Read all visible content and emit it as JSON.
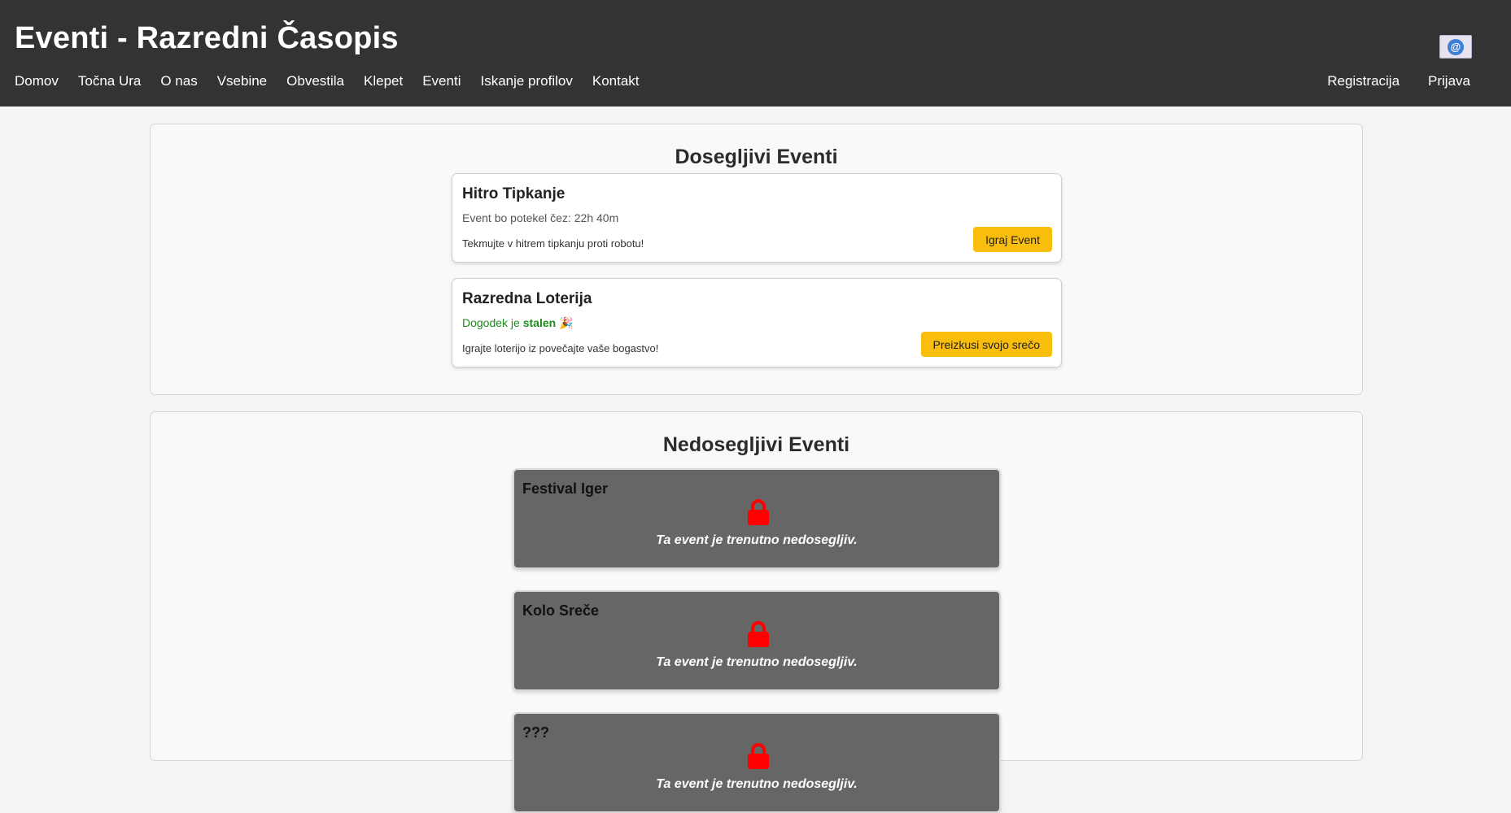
{
  "header": {
    "title": "Eventi - Razredni Časopis",
    "nav_left": [
      "Domov",
      "Točna Ura",
      "O nas",
      "Vsebine",
      "Obvestila",
      "Klepet",
      "Eventi",
      "Iskanje profilov",
      "Kontakt"
    ],
    "nav_right": [
      "Registracija",
      "Prijava"
    ],
    "mail_icon": "@"
  },
  "available": {
    "title": "Dosegljivi Eventi",
    "events": [
      {
        "name": "Hitro Tipkanje",
        "status": "Event bo potekel čez: 22h 40m",
        "description": "Tekmujte v hitrem tipkanju proti robotu!",
        "button": "Igraj Event"
      },
      {
        "name": "Razredna Loterija",
        "status_prefix": "Dogodek je ",
        "status_bold": "stalen",
        "status_emoji": "🎉",
        "description": "Igrajte loterijo iz povečajte vaše bogastvo!",
        "button": "Preizkusi svojo srečo"
      }
    ]
  },
  "unavailable": {
    "title": "Nedosegljivi Eventi",
    "message": "Ta event je trenutno nedosegljiv.",
    "events": [
      {
        "name": "Festival Iger"
      },
      {
        "name": "Kolo Sreče"
      },
      {
        "name": "???"
      }
    ]
  },
  "colors": {
    "header_bg": "#333333",
    "button_yellow": "#f9bd0b",
    "lock_red": "#ff0000",
    "locked_card_bg": "#666666",
    "status_green": "#1d8a1d"
  }
}
